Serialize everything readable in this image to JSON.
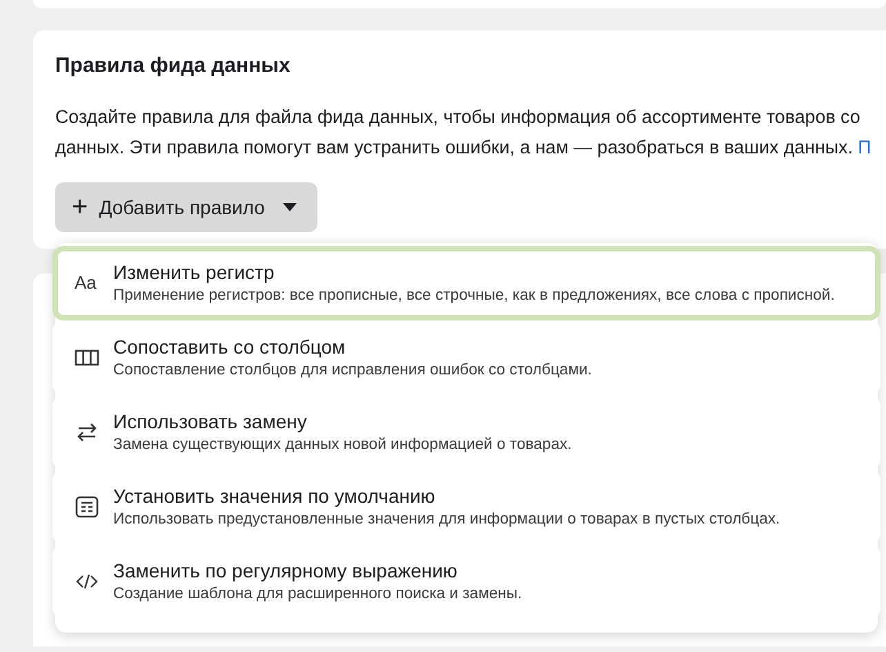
{
  "card": {
    "title": "Правила фида данных",
    "description_lines": [
      "Создайте правила для файла фида данных, чтобы информация об ассортименте товаров со",
      "данных. Эти правила помогут вам устранить ошибки, а нам — разобраться в ваших данных."
    ],
    "link": "П",
    "add_button": {
      "icon": "+",
      "label": "Добавить правило"
    }
  },
  "menu": {
    "items": [
      {
        "kind": "case",
        "icon_text": "Aa",
        "title": "Изменить регистр",
        "description": "Применение регистров: все прописные, все строчные, как в предложениях, все слова с прописной.",
        "selected": true
      },
      {
        "kind": "columns",
        "title": "Сопоставить со столбцом",
        "description": "Сопоставление столбцов для исправления ошибок со столбцами.",
        "selected": false
      },
      {
        "kind": "replace",
        "title": "Использовать замену",
        "description": "Замена существующих данных новой информацией о товарах.",
        "selected": false
      },
      {
        "kind": "defaults",
        "title": "Установить значения по умолчанию",
        "description": "Использовать предустановленные значения для информации о товарах в пустых столбцах.",
        "selected": false
      },
      {
        "kind": "regex",
        "title": "Заменить по регулярному выражению",
        "description": "Создание шаблона для расширенного поиска и замены.",
        "selected": false
      }
    ]
  }
}
